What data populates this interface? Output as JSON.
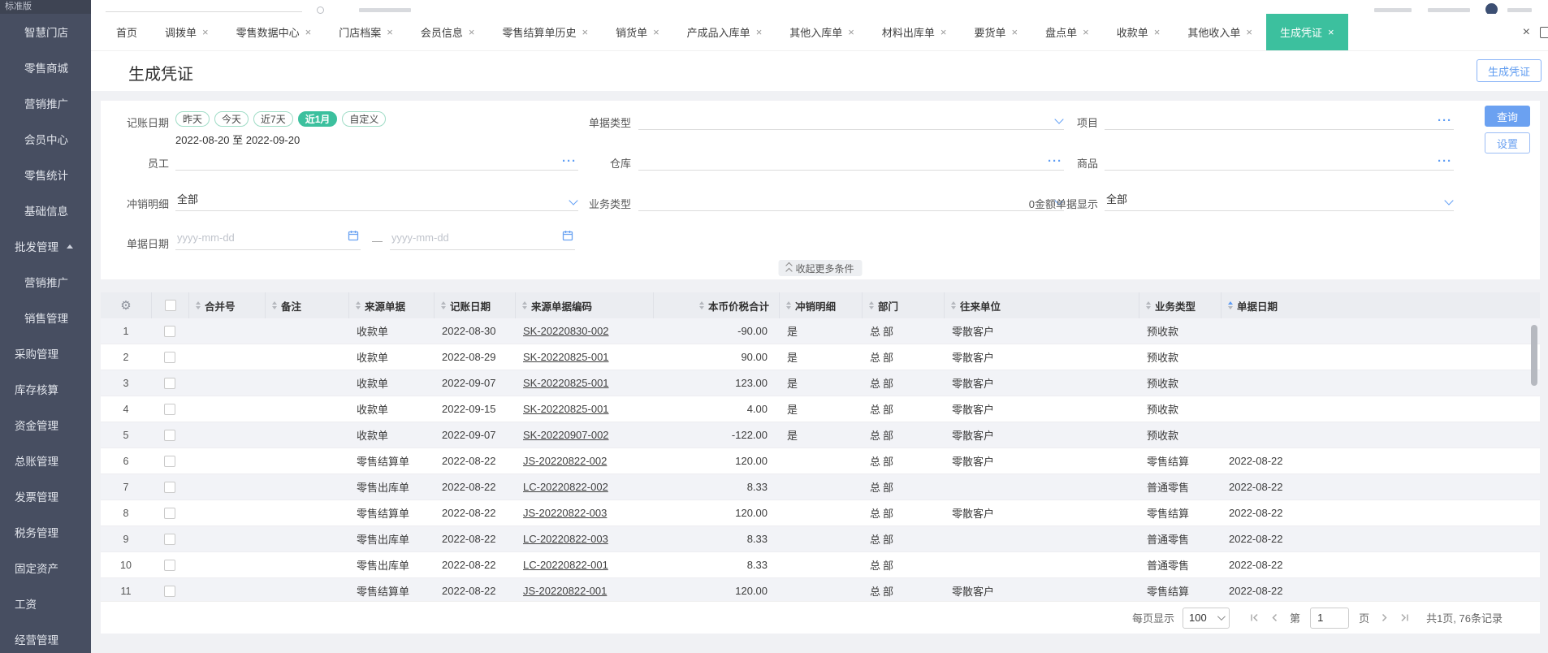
{
  "colors": {
    "accent_green": "#3cc09e",
    "accent_blue": "#5e9df5",
    "sidebar_bg": "#474e61",
    "table_header_bg": "#ebedf1",
    "stripe_bg": "#f2f3f7"
  },
  "sidebar": {
    "edition": "标准版",
    "items": [
      {
        "label": "智慧门店",
        "indent": true
      },
      {
        "label": "零售商城",
        "indent": true
      },
      {
        "label": "营销推广",
        "indent": true
      },
      {
        "label": "会员中心",
        "indent": true
      },
      {
        "label": "零售统计",
        "indent": true
      },
      {
        "label": "基础信息",
        "indent": true
      },
      {
        "label": "批发管理",
        "expanded": true,
        "divider": true
      },
      {
        "label": "营销推广",
        "indent": true
      },
      {
        "label": "销售管理",
        "indent": true
      },
      {
        "label": "采购管理",
        "divider": true
      },
      {
        "label": "库存核算"
      },
      {
        "label": "资金管理"
      },
      {
        "label": "总账管理"
      },
      {
        "label": "发票管理"
      },
      {
        "label": "税务管理"
      },
      {
        "label": "固定资产"
      },
      {
        "label": "工资"
      },
      {
        "label": "经营管理"
      }
    ]
  },
  "tabs": [
    {
      "label": "首页",
      "closable": false
    },
    {
      "label": "调拨单",
      "closable": true
    },
    {
      "label": "零售数据中心",
      "closable": true
    },
    {
      "label": "门店档案",
      "closable": true
    },
    {
      "label": "会员信息",
      "closable": true
    },
    {
      "label": "零售结算单历史",
      "closable": true
    },
    {
      "label": "销货单",
      "closable": true
    },
    {
      "label": "产成品入库单",
      "closable": true
    },
    {
      "label": "其他入库单",
      "closable": true
    },
    {
      "label": "材料出库单",
      "closable": true
    },
    {
      "label": "要货单",
      "closable": true
    },
    {
      "label": "盘点单",
      "closable": true
    },
    {
      "label": "收款单",
      "closable": true
    },
    {
      "label": "其他收入单",
      "closable": true
    },
    {
      "label": "生成凭证",
      "closable": true,
      "active": true
    }
  ],
  "page": {
    "title": "生成凭证",
    "action_button": "生成凭证"
  },
  "filters": {
    "account_date": {
      "label": "记账日期",
      "presets": [
        {
          "label": "昨天"
        },
        {
          "label": "今天"
        },
        {
          "label": "近7天"
        },
        {
          "label": "近1月",
          "selected": true
        },
        {
          "label": "自定义"
        }
      ],
      "range": "2022-08-20 至 2022-09-20"
    },
    "doc_type": {
      "label": "单据类型",
      "value": ""
    },
    "project": {
      "label": "项目",
      "value": ""
    },
    "employee": {
      "label": "员工",
      "value": ""
    },
    "warehouse": {
      "label": "仓库",
      "value": ""
    },
    "goods": {
      "label": "商品",
      "value": ""
    },
    "writeoff_detail": {
      "label": "冲销明细",
      "value": "全部"
    },
    "business_type": {
      "label": "业务类型",
      "value": ""
    },
    "zero_amount": {
      "label": "0金额单据显示",
      "value": "全部"
    },
    "doc_date": {
      "label": "单据日期",
      "start_placeholder": "yyyy-mm-dd",
      "end_placeholder": "yyyy-mm-dd"
    },
    "collapse_label": "收起更多条件",
    "search_btn": "查询",
    "settings_btn": "设置"
  },
  "table": {
    "columns": [
      {
        "label": "合并号"
      },
      {
        "label": "备注"
      },
      {
        "label": "来源单据"
      },
      {
        "label": "记账日期"
      },
      {
        "label": "来源单据编码"
      },
      {
        "label": "本币价税合计"
      },
      {
        "label": "冲销明细"
      },
      {
        "label": "部门"
      },
      {
        "label": "往来单位"
      },
      {
        "label": "业务类型"
      },
      {
        "label": "单据日期",
        "asc": true
      }
    ],
    "rows": [
      {
        "n": "1",
        "merge": "",
        "note": "",
        "src": "收款单",
        "adate": "2022-08-30",
        "code": "SK-20220830-002",
        "amount": "-90.00",
        "wo": "是",
        "dept": "总部",
        "partner": "零散客户",
        "btype": "预收款",
        "ddate": ""
      },
      {
        "n": "2",
        "merge": "",
        "note": "",
        "src": "收款单",
        "adate": "2022-08-29",
        "code": "SK-20220825-001",
        "amount": "90.00",
        "wo": "是",
        "dept": "总部",
        "partner": "零散客户",
        "btype": "预收款",
        "ddate": ""
      },
      {
        "n": "3",
        "merge": "",
        "note": "",
        "src": "收款单",
        "adate": "2022-09-07",
        "code": "SK-20220825-001",
        "amount": "123.00",
        "wo": "是",
        "dept": "总部",
        "partner": "零散客户",
        "btype": "预收款",
        "ddate": ""
      },
      {
        "n": "4",
        "merge": "",
        "note": "",
        "src": "收款单",
        "adate": "2022-09-15",
        "code": "SK-20220825-001",
        "amount": "4.00",
        "wo": "是",
        "dept": "总部",
        "partner": "零散客户",
        "btype": "预收款",
        "ddate": ""
      },
      {
        "n": "5",
        "merge": "",
        "note": "",
        "src": "收款单",
        "adate": "2022-09-07",
        "code": "SK-20220907-002",
        "amount": "-122.00",
        "wo": "是",
        "dept": "总部",
        "partner": "零散客户",
        "btype": "预收款",
        "ddate": ""
      },
      {
        "n": "6",
        "merge": "",
        "note": "",
        "src": "零售结算单",
        "adate": "2022-08-22",
        "code": "JS-20220822-002",
        "amount": "120.00",
        "wo": "",
        "dept": "总部",
        "partner": "零散客户",
        "btype": "零售结算",
        "ddate": "2022-08-22"
      },
      {
        "n": "7",
        "merge": "",
        "note": "",
        "src": "零售出库单",
        "adate": "2022-08-22",
        "code": "LC-20220822-002",
        "amount": "8.33",
        "wo": "",
        "dept": "总部",
        "partner": "",
        "btype": "普通零售",
        "ddate": "2022-08-22"
      },
      {
        "n": "8",
        "merge": "",
        "note": "",
        "src": "零售结算单",
        "adate": "2022-08-22",
        "code": "JS-20220822-003",
        "amount": "120.00",
        "wo": "",
        "dept": "总部",
        "partner": "零散客户",
        "btype": "零售结算",
        "ddate": "2022-08-22"
      },
      {
        "n": "9",
        "merge": "",
        "note": "",
        "src": "零售出库单",
        "adate": "2022-08-22",
        "code": "LC-20220822-003",
        "amount": "8.33",
        "wo": "",
        "dept": "总部",
        "partner": "",
        "btype": "普通零售",
        "ddate": "2022-08-22"
      },
      {
        "n": "10",
        "merge": "",
        "note": "",
        "src": "零售出库单",
        "adate": "2022-08-22",
        "code": "LC-20220822-001",
        "amount": "8.33",
        "wo": "",
        "dept": "总部",
        "partner": "",
        "btype": "普通零售",
        "ddate": "2022-08-22"
      },
      {
        "n": "11",
        "merge": "",
        "note": "",
        "src": "零售结算单",
        "adate": "2022-08-22",
        "code": "JS-20220822-001",
        "amount": "120.00",
        "wo": "",
        "dept": "总部",
        "partner": "零散客户",
        "btype": "零售结算",
        "ddate": "2022-08-22"
      }
    ]
  },
  "pagination": {
    "per_page_label": "每页显示",
    "per_page": "100",
    "page_prefix": "第",
    "page": "1",
    "page_suffix": "页",
    "total": "共1页, 76条记录"
  }
}
